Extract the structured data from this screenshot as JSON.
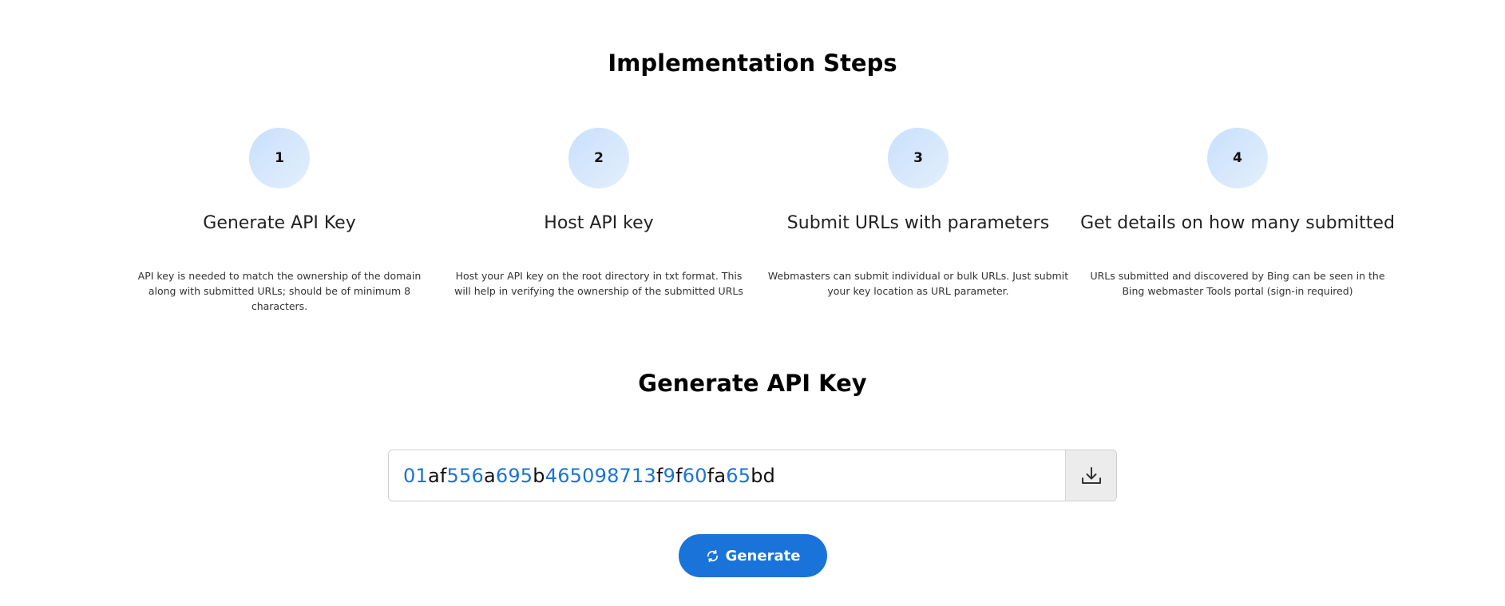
{
  "steps_section": {
    "title": "Implementation Steps",
    "steps": [
      {
        "number": "1",
        "title": "Generate API Key",
        "description": "API key is needed to match the ownership of the domain along with submitted URLs; should be of minimum 8 characters."
      },
      {
        "number": "2",
        "title": "Host API key",
        "description": "Host your API key on the root directory in txt format. This will help in verifying the ownership of the submitted URLs"
      },
      {
        "number": "3",
        "title": "Submit URLs with parameters",
        "description": "Webmasters can submit individual or bulk URLs. Just submit your key location as URL parameter."
      },
      {
        "number": "4",
        "title": "Get details on how many submitted",
        "description": "URLs submitted and discovered by Bing can be seen in the Bing webmaster Tools portal (sign-in required)"
      }
    ]
  },
  "generate_section": {
    "title": "Generate API Key",
    "api_key": "01af556a695b465098713f9f60fa65bd",
    "download_icon": "download-icon",
    "generate_label": "Generate",
    "generate_icon": "refresh-icon"
  },
  "colors": {
    "accent": "#1a73d9",
    "circle_light": "#dbeafc",
    "download_bg": "#ececec"
  }
}
